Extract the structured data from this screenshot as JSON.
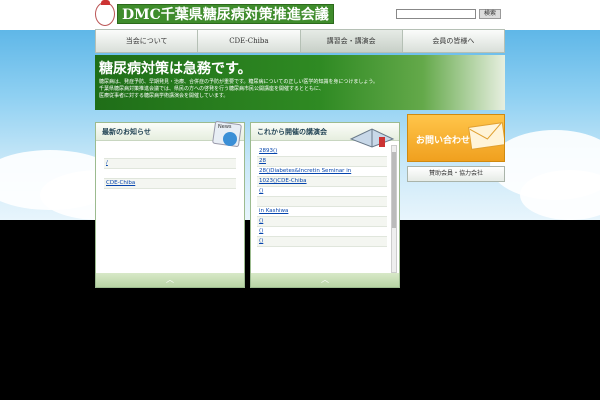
{
  "header": {
    "logo_text": "DMC千葉県糖尿病対策推進会議",
    "search_button": "検索"
  },
  "nav": [
    {
      "label": "当会について"
    },
    {
      "label": "CDE-Chiba"
    },
    {
      "label": "講習会・講演会"
    },
    {
      "label": "会員の皆様へ"
    }
  ],
  "hero": {
    "title": "糖尿病対策は急務です。",
    "lines": [
      "糖尿病は、発症予防、早期発見・治療、合併症の予防が重要です。糖尿病についての正しい医学的知識を身につけましょう。",
      "千葉県糖尿病対策推進会議では、県民の方への啓発を行う糖尿病市民公開講座を開催するとともに、",
      "医療従事者に対する糖尿病学術講演会を開催しています。"
    ]
  },
  "news": {
    "title": "最新のお知らせ",
    "badge": "News",
    "items": [
      "",
      "/",
      "",
      "CDE-Chiba"
    ]
  },
  "events": {
    "title": "これから開催の講演会",
    "items": [
      "2893()",
      "28",
      "28()Diabetes&Incretin Seminar in",
      "1023()CDE-Chiba",
      "()",
      "",
      " in Kashiwa",
      "()",
      "()",
      "()"
    ]
  },
  "sidebar": {
    "contact": "お問い合わせ",
    "sponsor": "賛助会員・協力会社"
  },
  "colors": {
    "brand_green": "#2f8a23",
    "contact_orange": "#f0a01f"
  }
}
